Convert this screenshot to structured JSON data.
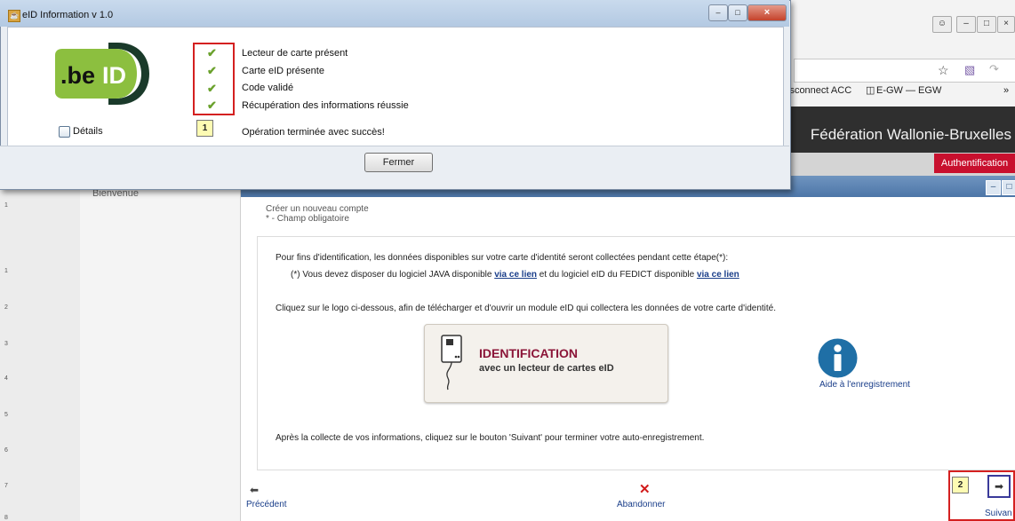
{
  "dialog": {
    "title": "eID Information v 1.0",
    "logo_text": ".beID",
    "details_label": "Détails",
    "status_items": [
      {
        "label": "Lecteur de carte présent"
      },
      {
        "label": "Carte eID présente"
      },
      {
        "label": "Code validé"
      },
      {
        "label": "Récupération des informations réussie"
      }
    ],
    "callout": "1",
    "result": "Opération terminée avec succès!",
    "close_label": "Fermer"
  },
  "browser": {
    "bookmarks": [
      "isconnect ACC",
      "E-GW — EGW"
    ],
    "overflow": "»",
    "site_title": "Fédération Wallonie-Bruxelles",
    "auth_label": "Authentification"
  },
  "sidebar": {
    "welcome": "Bienvenue"
  },
  "main": {
    "breadcrumb": "Créer un nouveau compte",
    "required_note": "* - Champ obligatoire",
    "intro": "Pour fins d'identification, les données disponibles sur votre carte d'identité seront collectées pendant cette étape(*):",
    "note_prefix": "(*) Vous devez disposer du logiciel JAVA disponible ",
    "link1": "via ce lien",
    "note_middle": " et du logiciel eID du FEDICT disponible ",
    "link2": "via ce lien",
    "instruction": "Cliquez sur le logo ci-dessous, afin de télécharger et d'ouvrir un module eID qui collectera les données de votre carte d'identité.",
    "id_button_title": "IDENTIFICATION",
    "id_button_sub": "avec un lecteur de cartes eID",
    "help_label": "Aide à l'enregistrement",
    "after": "Après la collecte de vos informations, cliquez sur le bouton 'Suivant' pour terminer votre auto-enregistrement."
  },
  "nav": {
    "prev": "Précédent",
    "cancel": "Abandonner",
    "next": "Suivan",
    "callout": "2"
  },
  "ruler_numbers": [
    "1",
    "1",
    "2",
    "3",
    "4",
    "5",
    "6",
    "7",
    "8"
  ],
  "colors": {
    "accent_red": "#c8102e",
    "check_green": "#6aa12c",
    "link_blue": "#1a3e8a"
  }
}
